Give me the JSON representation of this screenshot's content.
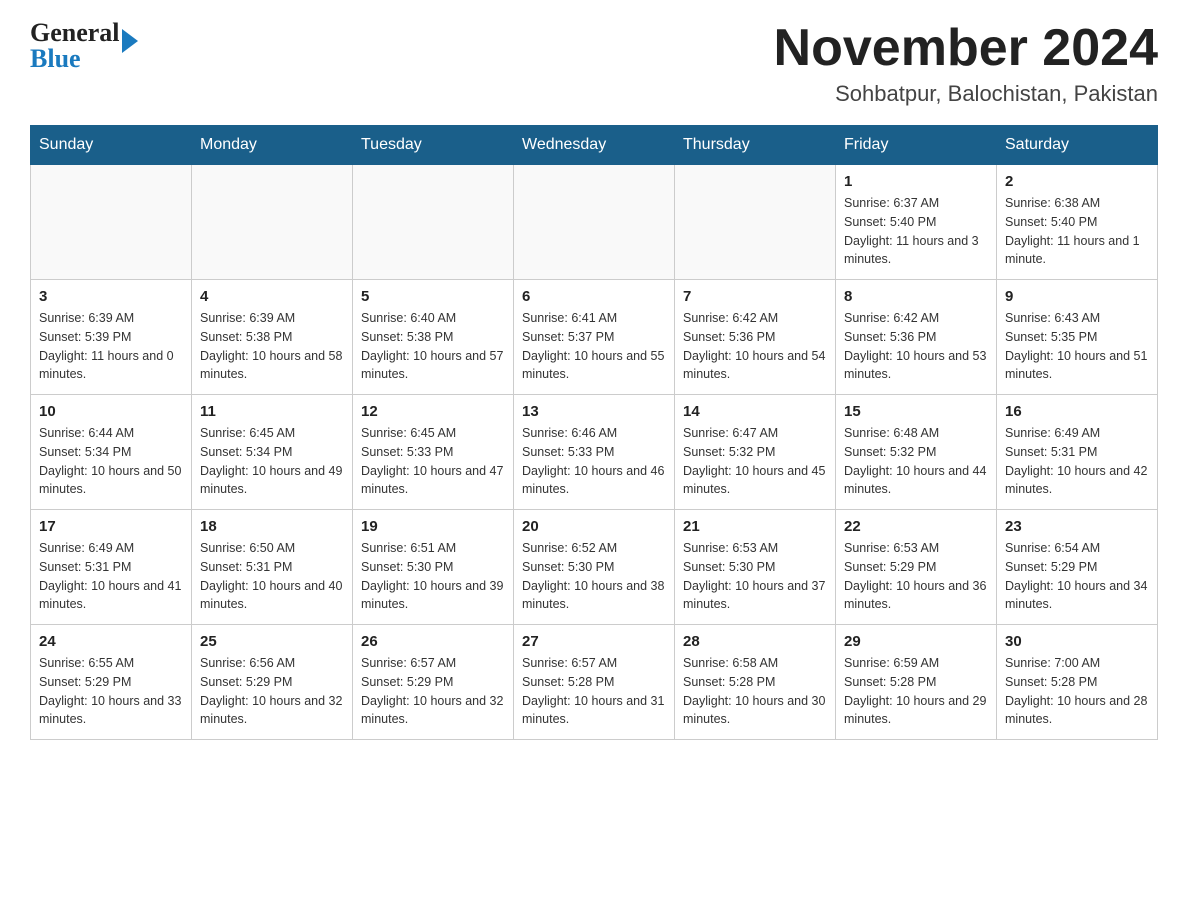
{
  "header": {
    "logo_line1": "General",
    "logo_line2": "Blue",
    "month_title": "November 2024",
    "subtitle": "Sohbatpur, Balochistan, Pakistan"
  },
  "weekdays": [
    "Sunday",
    "Monday",
    "Tuesday",
    "Wednesday",
    "Thursday",
    "Friday",
    "Saturday"
  ],
  "weeks": [
    [
      {
        "day": "",
        "info": ""
      },
      {
        "day": "",
        "info": ""
      },
      {
        "day": "",
        "info": ""
      },
      {
        "day": "",
        "info": ""
      },
      {
        "day": "",
        "info": ""
      },
      {
        "day": "1",
        "info": "Sunrise: 6:37 AM\nSunset: 5:40 PM\nDaylight: 11 hours and 3 minutes."
      },
      {
        "day": "2",
        "info": "Sunrise: 6:38 AM\nSunset: 5:40 PM\nDaylight: 11 hours and 1 minute."
      }
    ],
    [
      {
        "day": "3",
        "info": "Sunrise: 6:39 AM\nSunset: 5:39 PM\nDaylight: 11 hours and 0 minutes."
      },
      {
        "day": "4",
        "info": "Sunrise: 6:39 AM\nSunset: 5:38 PM\nDaylight: 10 hours and 58 minutes."
      },
      {
        "day": "5",
        "info": "Sunrise: 6:40 AM\nSunset: 5:38 PM\nDaylight: 10 hours and 57 minutes."
      },
      {
        "day": "6",
        "info": "Sunrise: 6:41 AM\nSunset: 5:37 PM\nDaylight: 10 hours and 55 minutes."
      },
      {
        "day": "7",
        "info": "Sunrise: 6:42 AM\nSunset: 5:36 PM\nDaylight: 10 hours and 54 minutes."
      },
      {
        "day": "8",
        "info": "Sunrise: 6:42 AM\nSunset: 5:36 PM\nDaylight: 10 hours and 53 minutes."
      },
      {
        "day": "9",
        "info": "Sunrise: 6:43 AM\nSunset: 5:35 PM\nDaylight: 10 hours and 51 minutes."
      }
    ],
    [
      {
        "day": "10",
        "info": "Sunrise: 6:44 AM\nSunset: 5:34 PM\nDaylight: 10 hours and 50 minutes."
      },
      {
        "day": "11",
        "info": "Sunrise: 6:45 AM\nSunset: 5:34 PM\nDaylight: 10 hours and 49 minutes."
      },
      {
        "day": "12",
        "info": "Sunrise: 6:45 AM\nSunset: 5:33 PM\nDaylight: 10 hours and 47 minutes."
      },
      {
        "day": "13",
        "info": "Sunrise: 6:46 AM\nSunset: 5:33 PM\nDaylight: 10 hours and 46 minutes."
      },
      {
        "day": "14",
        "info": "Sunrise: 6:47 AM\nSunset: 5:32 PM\nDaylight: 10 hours and 45 minutes."
      },
      {
        "day": "15",
        "info": "Sunrise: 6:48 AM\nSunset: 5:32 PM\nDaylight: 10 hours and 44 minutes."
      },
      {
        "day": "16",
        "info": "Sunrise: 6:49 AM\nSunset: 5:31 PM\nDaylight: 10 hours and 42 minutes."
      }
    ],
    [
      {
        "day": "17",
        "info": "Sunrise: 6:49 AM\nSunset: 5:31 PM\nDaylight: 10 hours and 41 minutes."
      },
      {
        "day": "18",
        "info": "Sunrise: 6:50 AM\nSunset: 5:31 PM\nDaylight: 10 hours and 40 minutes."
      },
      {
        "day": "19",
        "info": "Sunrise: 6:51 AM\nSunset: 5:30 PM\nDaylight: 10 hours and 39 minutes."
      },
      {
        "day": "20",
        "info": "Sunrise: 6:52 AM\nSunset: 5:30 PM\nDaylight: 10 hours and 38 minutes."
      },
      {
        "day": "21",
        "info": "Sunrise: 6:53 AM\nSunset: 5:30 PM\nDaylight: 10 hours and 37 minutes."
      },
      {
        "day": "22",
        "info": "Sunrise: 6:53 AM\nSunset: 5:29 PM\nDaylight: 10 hours and 36 minutes."
      },
      {
        "day": "23",
        "info": "Sunrise: 6:54 AM\nSunset: 5:29 PM\nDaylight: 10 hours and 34 minutes."
      }
    ],
    [
      {
        "day": "24",
        "info": "Sunrise: 6:55 AM\nSunset: 5:29 PM\nDaylight: 10 hours and 33 minutes."
      },
      {
        "day": "25",
        "info": "Sunrise: 6:56 AM\nSunset: 5:29 PM\nDaylight: 10 hours and 32 minutes."
      },
      {
        "day": "26",
        "info": "Sunrise: 6:57 AM\nSunset: 5:29 PM\nDaylight: 10 hours and 32 minutes."
      },
      {
        "day": "27",
        "info": "Sunrise: 6:57 AM\nSunset: 5:28 PM\nDaylight: 10 hours and 31 minutes."
      },
      {
        "day": "28",
        "info": "Sunrise: 6:58 AM\nSunset: 5:28 PM\nDaylight: 10 hours and 30 minutes."
      },
      {
        "day": "29",
        "info": "Sunrise: 6:59 AM\nSunset: 5:28 PM\nDaylight: 10 hours and 29 minutes."
      },
      {
        "day": "30",
        "info": "Sunrise: 7:00 AM\nSunset: 5:28 PM\nDaylight: 10 hours and 28 minutes."
      }
    ]
  ]
}
